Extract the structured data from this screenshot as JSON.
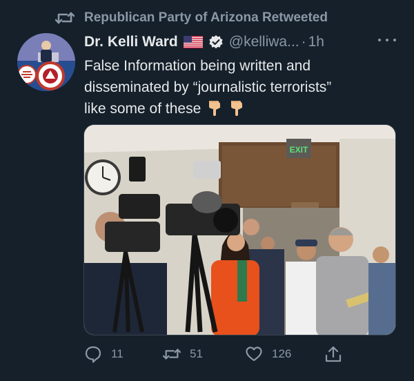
{
  "retweet_banner": {
    "text": "Republican Party of Arizona Retweeted",
    "icon": "retweet-icon"
  },
  "author": {
    "display_name": "Dr. Kelli Ward",
    "handle": "@kelliwa...",
    "separator": "·",
    "time": "1h",
    "flag": "us-flag-emoji",
    "verified": true
  },
  "tweet": {
    "lines": [
      "False Information being written and",
      "disseminated by “journalistic terrorists”",
      "like some of these"
    ],
    "emoji": "backhand-index-pointing-down"
  },
  "media": {
    "exit_sign": "EXIT"
  },
  "actions": {
    "reply_count": "11",
    "retweet_count": "51",
    "like_count": "126"
  },
  "colors": {
    "background": "#15202b",
    "text": "#e7e9ea",
    "muted": "#8b98a5",
    "verified": "#1d9bf0"
  }
}
